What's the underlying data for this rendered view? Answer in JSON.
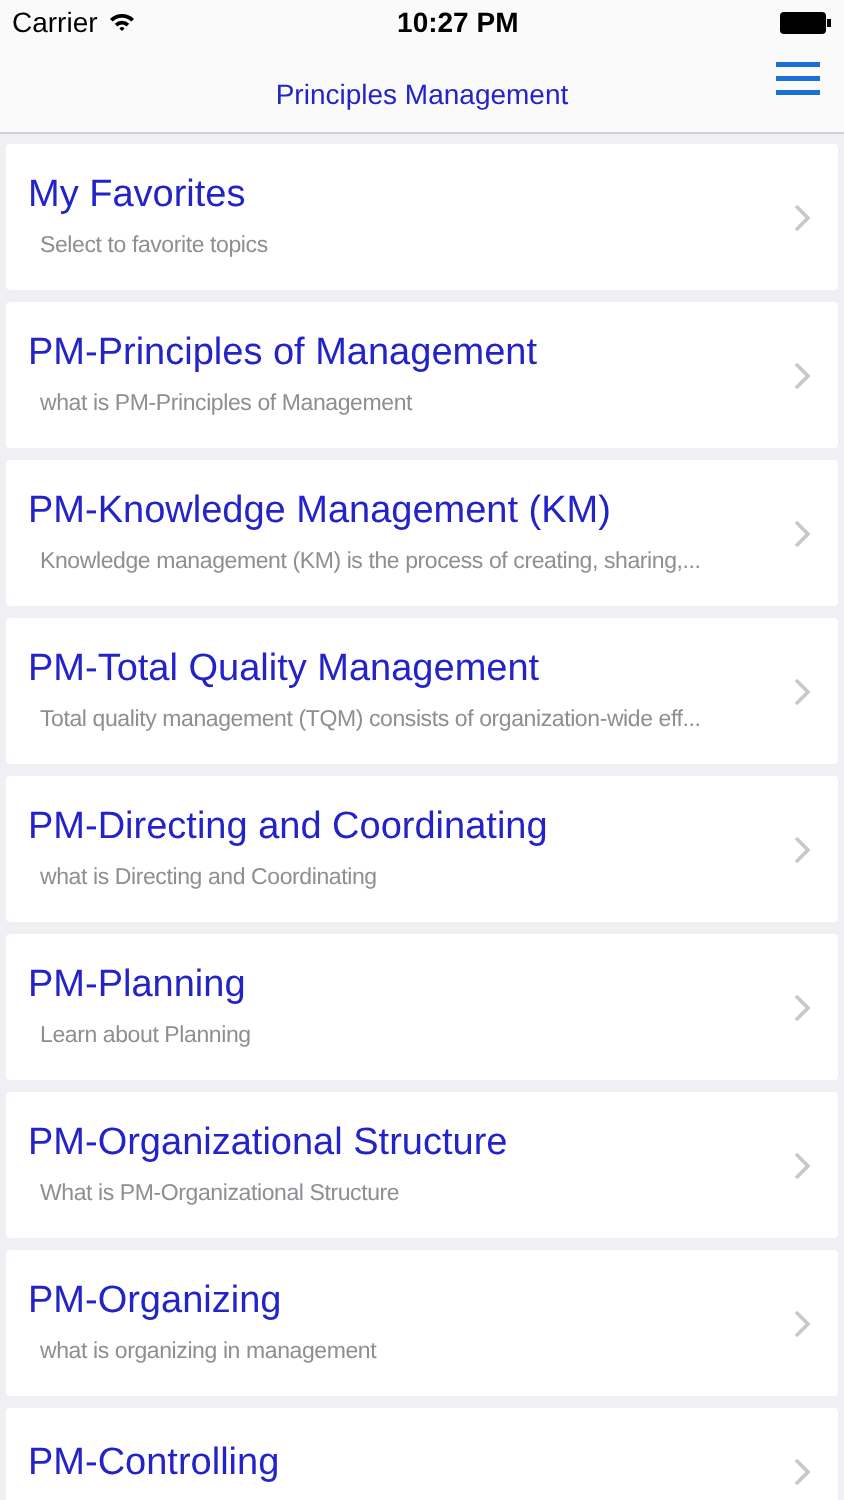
{
  "status_bar": {
    "carrier": "Carrier",
    "time": "10:27 PM"
  },
  "nav_bar": {
    "title": "Principles Management"
  },
  "topics": [
    {
      "title": "My Favorites",
      "subtitle": "Select to favorite topics"
    },
    {
      "title": "PM-Principles of Management",
      "subtitle": "what is PM-Principles of Management"
    },
    {
      "title": "PM-Knowledge Management (KM)",
      "subtitle": "Knowledge management (KM) is the process of creating, sharing,..."
    },
    {
      "title": "PM-Total Quality Management",
      "subtitle": "Total quality management (TQM) consists of organization-wide eff..."
    },
    {
      "title": "PM-Directing and Coordinating",
      "subtitle": "what is Directing and Coordinating"
    },
    {
      "title": "PM-Planning",
      "subtitle": "Learn about Planning"
    },
    {
      "title": "PM-Organizational Structure",
      "subtitle": "What is PM-Organizational Structure"
    },
    {
      "title": "PM-Organizing",
      "subtitle": "what is organizing in management"
    },
    {
      "title": "PM-Controlling"
    }
  ]
}
